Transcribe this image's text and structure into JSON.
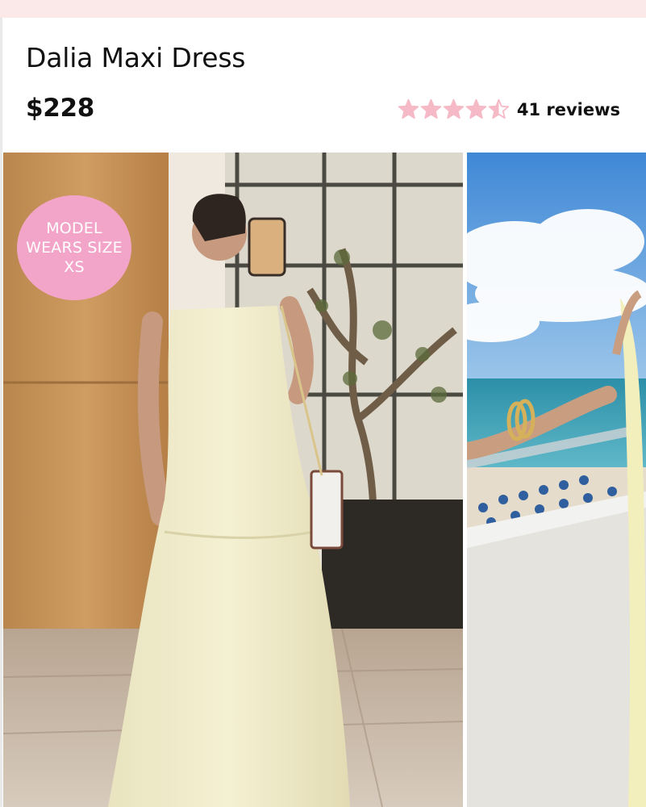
{
  "product": {
    "title": "Dalia Maxi Dress",
    "price": "$228"
  },
  "rating": {
    "stars": 4.5,
    "max": 5,
    "reviews_label": "41 reviews",
    "star_color": "#f6b9c6"
  },
  "badge": {
    "text": "MODEL WEARS SIZE XS",
    "color": "#f3a5c9"
  },
  "gallery": {
    "images": [
      {
        "description_icon": "product-photo-model-indoor"
      },
      {
        "description_icon": "product-photo-model-balcony"
      }
    ]
  },
  "colors": {
    "header_strip": "#fbe9e9"
  }
}
